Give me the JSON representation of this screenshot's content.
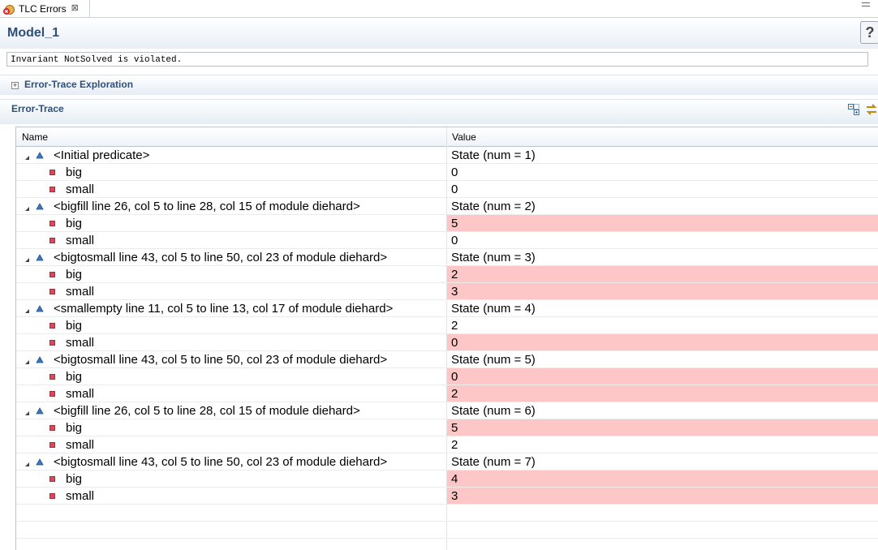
{
  "tab": {
    "label": "TLC Errors",
    "close": "⊠"
  },
  "header": {
    "title": "Model_1",
    "help": "?"
  },
  "message": "Invariant NotSolved is violated.",
  "sections": {
    "exploration": "Error-Trace Exploration",
    "trace": "Error-Trace"
  },
  "table": {
    "columns": [
      "Name",
      "Value"
    ],
    "highlight_color": "#fdc7c7",
    "rows": [
      {
        "kind": "state",
        "name": "<Initial predicate>",
        "value": "State (num = 1)",
        "changed": false
      },
      {
        "kind": "var",
        "name": "big",
        "value": "0",
        "changed": false
      },
      {
        "kind": "var",
        "name": "small",
        "value": "0",
        "changed": false
      },
      {
        "kind": "state",
        "name": "<bigfill line 26, col 5 to line 28, col 15 of module diehard>",
        "value": "State (num = 2)",
        "changed": false
      },
      {
        "kind": "var",
        "name": "big",
        "value": "5",
        "changed": true
      },
      {
        "kind": "var",
        "name": "small",
        "value": "0",
        "changed": false
      },
      {
        "kind": "state",
        "name": "<bigtosmall line 43, col 5 to line 50, col 23 of module diehard>",
        "value": "State (num = 3)",
        "changed": false
      },
      {
        "kind": "var",
        "name": "big",
        "value": "2",
        "changed": true
      },
      {
        "kind": "var",
        "name": "small",
        "value": "3",
        "changed": true
      },
      {
        "kind": "state",
        "name": "<smallempty line 11, col 5 to line 13, col 17 of module diehard>",
        "value": "State (num = 4)",
        "changed": false
      },
      {
        "kind": "var",
        "name": "big",
        "value": "2",
        "changed": false
      },
      {
        "kind": "var",
        "name": "small",
        "value": "0",
        "changed": true
      },
      {
        "kind": "state",
        "name": "<bigtosmall line 43, col 5 to line 50, col 23 of module diehard>",
        "value": "State (num = 5)",
        "changed": false
      },
      {
        "kind": "var",
        "name": "big",
        "value": "0",
        "changed": true
      },
      {
        "kind": "var",
        "name": "small",
        "value": "2",
        "changed": true
      },
      {
        "kind": "state",
        "name": "<bigfill line 26, col 5 to line 28, col 15 of module diehard>",
        "value": "State (num = 6)",
        "changed": false
      },
      {
        "kind": "var",
        "name": "big",
        "value": "5",
        "changed": true
      },
      {
        "kind": "var",
        "name": "small",
        "value": "2",
        "changed": false
      },
      {
        "kind": "state",
        "name": "<bigtosmall line 43, col 5 to line 50, col 23 of module diehard>",
        "value": "State (num = 7)",
        "changed": false
      },
      {
        "kind": "var",
        "name": "big",
        "value": "4",
        "changed": true
      },
      {
        "kind": "var",
        "name": "small",
        "value": "3",
        "changed": true
      }
    ]
  }
}
